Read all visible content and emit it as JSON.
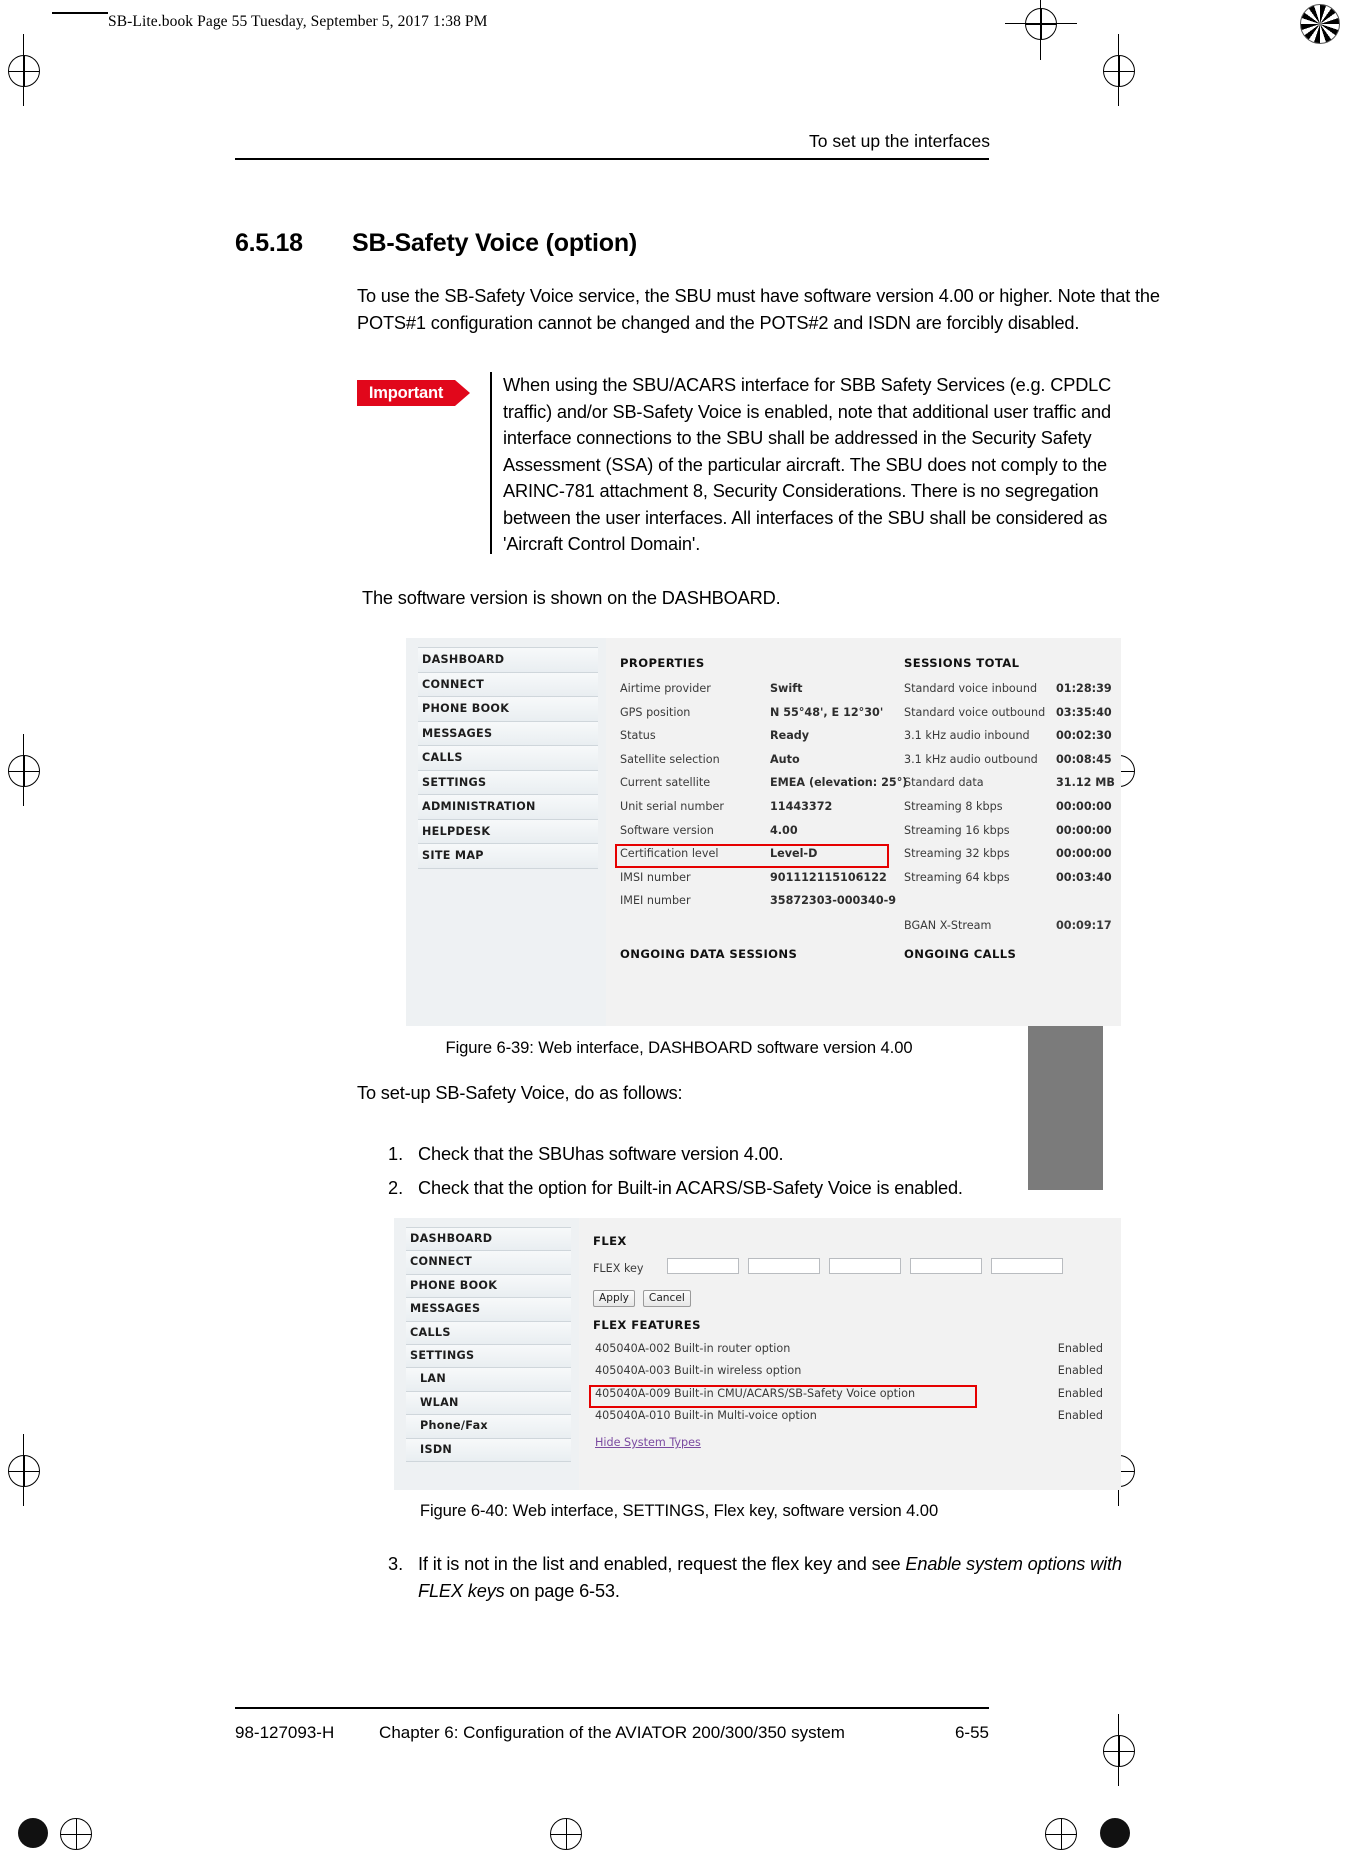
{
  "book_stamp": "SB-Lite.book  Page 55  Tuesday, September 5, 2017  1:38 PM",
  "header": {
    "running_head": "To set up the interfaces"
  },
  "section": {
    "number": "6.5.18",
    "title": "SB-Safety Voice (option)"
  },
  "intro_paragraph": "To use the SB-Safety Voice service, the SBU must have software version 4.00 or higher. Note that the POTS#1 configuration cannot be changed and the POTS#2 and ISDN are forcibly disabled.",
  "callout": {
    "badge": "Important",
    "text": "When using the SBU/ACARS interface for SBB Safety Services (e.g. CPDLC traffic) and/or SB-Safety Voice is enabled, note that additional user traffic and interface connections to the SBU shall be addressed in the Security Safety Assessment (SSA) of the particular aircraft. The SBU does not comply to the ARINC-781 attachment 8, Security Considerations. There is no segregation between the user interfaces. All interfaces of the SBU shall be considered as 'Aircraft Control Domain'."
  },
  "dashboard_note": "The software version is shown on the DASHBOARD.",
  "setup_lead": "To set-up SB-Safety Voice, do as follows:",
  "steps": [
    {
      "num": "1.",
      "text": "Check that the SBUhas software version 4.00."
    },
    {
      "num": "2.",
      "text": "Check that the option for Built-in ACARS/SB-Safety Voice is enabled."
    }
  ],
  "step3": {
    "num": "3.",
    "part1": "If it is not in the list and enabled, request the flex key and see ",
    "italic1": "Enable system options with FLEX keys",
    "part2": " on page 6-53."
  },
  "figure1": {
    "caption": "Figure 6-39: Web interface, DASHBOARD software version 4.00",
    "nav_items": [
      "DASHBOARD",
      "CONNECT",
      "PHONE BOOK",
      "MESSAGES",
      "CALLS",
      "SETTINGS",
      "ADMINISTRATION",
      "HELPDESK",
      "SITE MAP"
    ],
    "properties_heading": "PROPERTIES",
    "properties": [
      {
        "label": "Airtime provider",
        "value": "Swift"
      },
      {
        "label": "GPS position",
        "value": "N 55°48', E 12°30'"
      },
      {
        "label": "Status",
        "value": "Ready"
      },
      {
        "label": "Satellite selection",
        "value": "Auto"
      },
      {
        "label": "Current satellite",
        "value": "EMEA (elevation: 25°)"
      },
      {
        "label": "Unit serial number",
        "value": "11443372"
      },
      {
        "label": "Software version",
        "value": "4.00"
      },
      {
        "label": "Certification level",
        "value": "Level-D"
      },
      {
        "label": "IMSI number",
        "value": "901112115106122"
      },
      {
        "label": "IMEI number",
        "value": "35872303-000340-9"
      }
    ],
    "ongoing_data_heading": "ONGOING DATA SESSIONS",
    "sessions_heading": "SESSIONS TOTAL",
    "sessions": [
      {
        "label": "Standard voice inbound",
        "value": "01:28:39"
      },
      {
        "label": "Standard voice outbound",
        "value": "03:35:40"
      },
      {
        "label": "3.1 kHz audio inbound",
        "value": "00:02:30"
      },
      {
        "label": "3.1 kHz audio outbound",
        "value": "00:08:45"
      },
      {
        "label": "Standard data",
        "value": "31.12 MB"
      },
      {
        "label": "Streaming 8 kbps",
        "value": "00:00:00"
      },
      {
        "label": "Streaming 16 kbps",
        "value": "00:00:00"
      },
      {
        "label": "Streaming 32 kbps",
        "value": "00:00:00"
      },
      {
        "label": "Streaming 64 kbps",
        "value": "00:03:40"
      }
    ],
    "bgan": {
      "label": "BGAN X-Stream",
      "value": "00:09:17"
    },
    "ongoing_calls_heading": "ONGOING CALLS",
    "highlight_color": "#e60000"
  },
  "figure2": {
    "caption": "Figure 6-40: Web interface, SETTINGS, Flex key, software version 4.00",
    "nav_items": [
      "DASHBOARD",
      "CONNECT",
      "PHONE BOOK",
      "MESSAGES",
      "CALLS",
      "SETTINGS",
      "LAN",
      "WLAN",
      "Phone/Fax",
      "ISDN"
    ],
    "flex_heading": "FLEX",
    "flex_key_label": "FLEX key",
    "flex_key_values": [
      "",
      "",
      "",
      "",
      ""
    ],
    "apply_label": "Apply",
    "cancel_label": "Cancel",
    "features_heading": "FLEX FEATURES",
    "features": [
      {
        "code_label": "405040A-002  Built-in router option",
        "status": "Enabled"
      },
      {
        "code_label": "405040A-003  Built-in wireless option",
        "status": "Enabled"
      },
      {
        "code_label": "405040A-009  Built-in CMU/ACARS/SB-Safety Voice option",
        "status": "Enabled"
      },
      {
        "code_label": "405040A-010  Built-in Multi-voice option",
        "status": "Enabled"
      }
    ],
    "hide_link": "Hide System Types",
    "highlight_color": "#e60000"
  },
  "footer": {
    "left": "98-127093-H",
    "center": "Chapter 6:  Configuration of the AVIATOR 200/300/350 system",
    "right": "6-55"
  }
}
